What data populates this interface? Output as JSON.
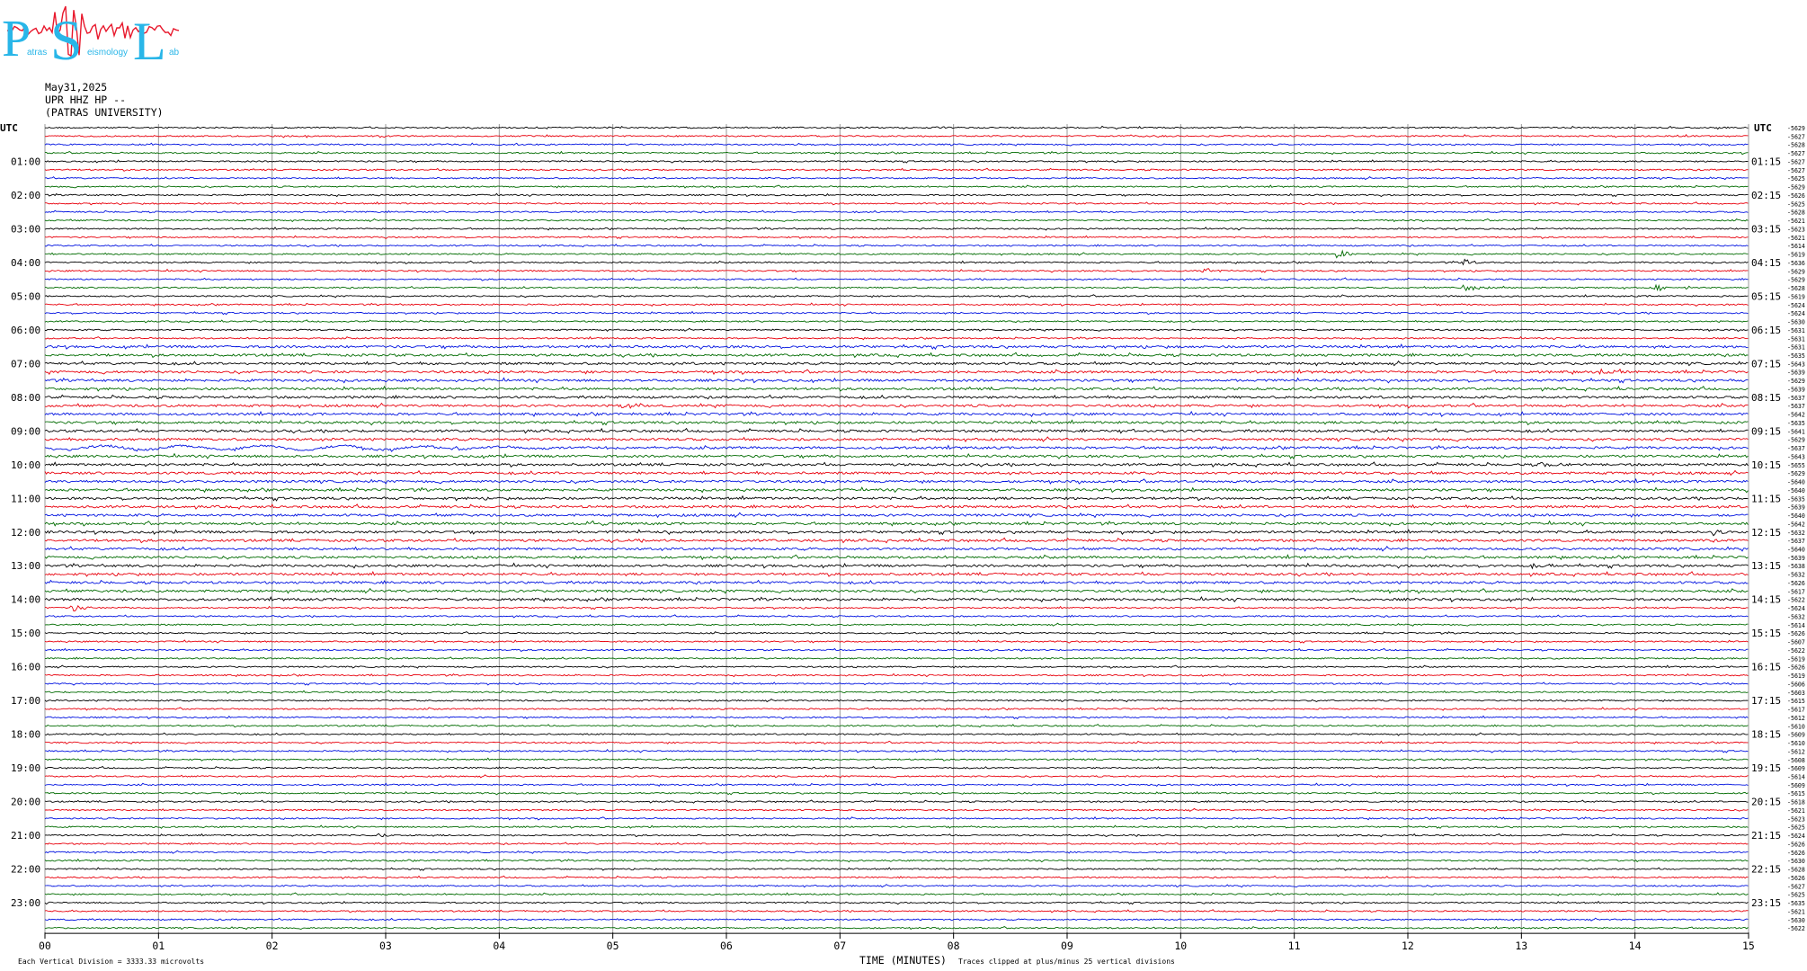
{
  "logo": {
    "letters": [
      "P",
      "S",
      "L"
    ],
    "subtitle_fragments": [
      "atras",
      "eismology",
      "ab"
    ],
    "color": "#29b6e8",
    "accent_color": "#e8182c"
  },
  "header": {
    "date": "May31,2025",
    "station": "UPR HHZ HP --",
    "institution": "(PATRAS UNIVERSITY)"
  },
  "chart_data": {
    "type": "line",
    "subtype": "helicorder",
    "timezone_label_left": "UTC",
    "timezone_label_right": "UTC",
    "xlabel": "TIME (MINUTES)",
    "x_ticks": [
      "00",
      "01",
      "02",
      "03",
      "04",
      "05",
      "06",
      "07",
      "08",
      "09",
      "10",
      "11",
      "12",
      "13",
      "14",
      "15"
    ],
    "xlim": [
      0,
      15
    ],
    "rows_per_hour": 4,
    "row_count": 96,
    "trace_colors": [
      "#000000",
      "#e8000c",
      "#0012e0",
      "#006b00"
    ],
    "left_hour_labels": [
      "01:00",
      "02:00",
      "03:00",
      "04:00",
      "05:00",
      "06:00",
      "07:00",
      "08:00",
      "09:00",
      "10:00",
      "11:00",
      "12:00",
      "13:00",
      "14:00",
      "15:00",
      "16:00",
      "17:00",
      "18:00",
      "19:00",
      "20:00",
      "21:00",
      "22:00",
      "23:00"
    ],
    "right_hour_labels": [
      "01:15",
      "02:15",
      "03:15",
      "04:15",
      "05:15",
      "06:15",
      "07:15",
      "08:15",
      "09:15",
      "10:15",
      "11:15",
      "12:15",
      "13:15",
      "14:15",
      "15:15",
      "16:15",
      "17:15",
      "18:15",
      "19:15",
      "20:15",
      "21:15",
      "22:15",
      "23:15"
    ],
    "row_offsets": [
      "-5629",
      "-5627",
      "-5628",
      "-5627",
      "-5627",
      "-5627",
      "-5625",
      "-5629",
      "-5626",
      "-5625",
      "-5628",
      "-5621",
      "-5623",
      "-5621",
      "-5614",
      "-5619",
      "-5636",
      "-5629",
      "-5629",
      "-5628",
      "-5619",
      "-5624",
      "-5624",
      "-5630",
      "-5631",
      "-5631",
      "-5631",
      "-5635",
      "-5643",
      "-5639",
      "-5629",
      "-5639",
      "-5637",
      "-5637",
      "-5642",
      "-5635",
      "-5641",
      "-5629",
      "-5637",
      "-5643",
      "-5655",
      "-5629",
      "-5640",
      "-5640",
      "-5635",
      "-5639",
      "-5640",
      "-5642",
      "-5632",
      "-5637",
      "-5640",
      "-5639",
      "-5638",
      "-5632",
      "-5626",
      "-5617",
      "-5622",
      "-5624",
      "-5632",
      "-5614",
      "-5626",
      "-5607",
      "-5622",
      "-5619",
      "-5626",
      "-5619",
      "-5606",
      "-5603",
      "-5615",
      "-5617",
      "-5612",
      "-5610",
      "-5609",
      "-5610",
      "-5612",
      "-5608",
      "-5609",
      "-5614",
      "-5609",
      "-5615",
      "-5618",
      "-5621",
      "-5623",
      "-5625",
      "-5624",
      "-5626",
      "-5626",
      "-5630",
      "-5628",
      "-5626",
      "-5627",
      "-5625",
      "-5635",
      "-5621",
      "-5630",
      "-5622"
    ],
    "footer_left": "Each Vertical Division = 3333.33 microvolts",
    "footer_right": "Traces clipped at plus/minus 25 vertical divisions",
    "events": [
      {
        "row": 15,
        "minute": 11.4,
        "amplitude": 4
      },
      {
        "row": 16,
        "minute": 12.5,
        "amplitude": 3
      },
      {
        "row": 17,
        "minute": 10.2,
        "amplitude": 3
      },
      {
        "row": 19,
        "minute": 12.5,
        "amplitude": 4
      },
      {
        "row": 19,
        "minute": 14.2,
        "amplitude": 3
      },
      {
        "row": 29,
        "minute": 13.7,
        "amplitude": 3
      },
      {
        "row": 33,
        "minute": 5.1,
        "amplitude": 3
      },
      {
        "row": 36,
        "minute": 9.5,
        "amplitude": 2
      },
      {
        "row": 40,
        "minute": 13.2,
        "amplitude": 3
      },
      {
        "row": 47,
        "minute": 4.8,
        "amplitude": 3
      },
      {
        "row": 48,
        "minute": 5.5,
        "amplitude": 3
      },
      {
        "row": 48,
        "minute": 14.7,
        "amplitude": 3
      },
      {
        "row": 52,
        "minute": 13.1,
        "amplitude": 4
      },
      {
        "row": 57,
        "minute": 0.25,
        "amplitude": 4
      },
      {
        "row": 84,
        "minute": 2.95,
        "amplitude": 2
      }
    ],
    "long_period_rows": [
      38
    ],
    "grid": true
  }
}
